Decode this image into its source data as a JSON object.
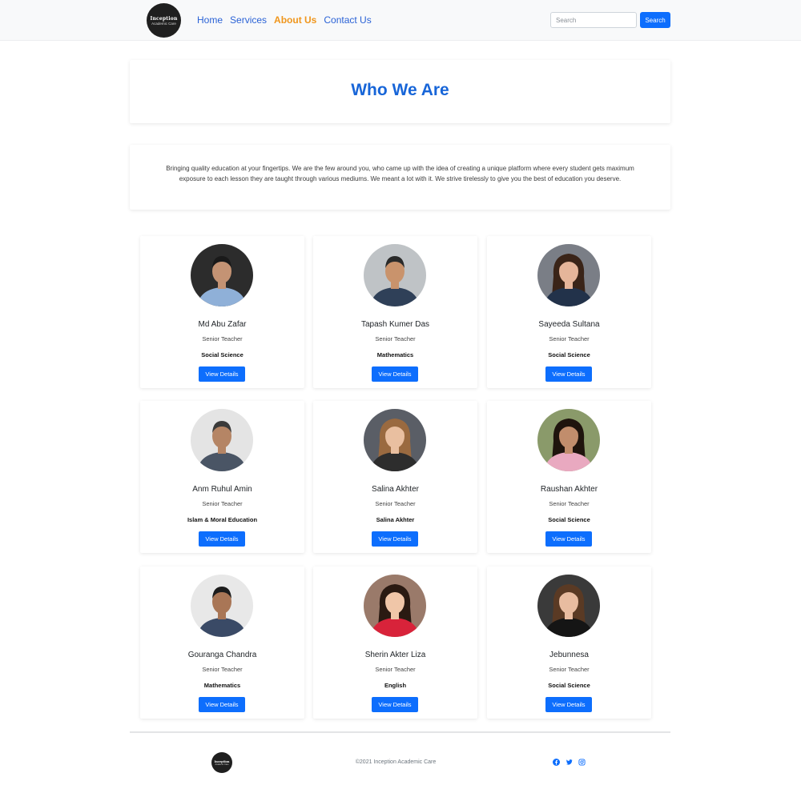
{
  "navbar": {
    "logo_line1": "Inception",
    "logo_line2": "Academic Care",
    "links": [
      "Home",
      "Services",
      "About Us",
      "Contact Us"
    ],
    "search_placeholder": "Search",
    "search_button": "Search"
  },
  "hero": {
    "title": "Who We Are"
  },
  "intro": {
    "text": "Bringing quality education at your fingertips. We are the few around you, who came up with the idea of creating a unique platform where every student gets maximum exposure to each lesson they are taught through various mediums. We meant a lot with it. We strive tirelessly to give you the best of education you deserve."
  },
  "teachers": [
    {
      "name": "Md Abu Zafar",
      "role": "Senior Teacher",
      "subject": "Social Science",
      "button": "View Details"
    },
    {
      "name": "Tapash Kumer Das",
      "role": "Senior Teacher",
      "subject": "Mathematics",
      "button": "View Details"
    },
    {
      "name": "Sayeeda Sultana",
      "role": "Senior Teacher",
      "subject": "Social Science",
      "button": "View Details"
    },
    {
      "name": "Anm Ruhul Amin",
      "role": "Senior Teacher",
      "subject": "Islam & Moral Education",
      "button": "View Details"
    },
    {
      "name": "Salina Akhter",
      "role": "Senior Teacher",
      "subject": "Salina Akhter",
      "button": "View Details"
    },
    {
      "name": "Raushan Akhter",
      "role": "Senior Teacher",
      "subject": "Social Science",
      "button": "View Details"
    },
    {
      "name": "Gouranga Chandra",
      "role": "Senior Teacher",
      "subject": "Mathematics",
      "button": "View Details"
    },
    {
      "name": "Sherin Akter Liza",
      "role": "Senior Teacher",
      "subject": "English",
      "button": "View Details"
    },
    {
      "name": "Jebunnesa",
      "role": "Senior Teacher",
      "subject": "Social Science",
      "button": "View Details"
    }
  ],
  "footer": {
    "logo_line1": "Inception",
    "logo_line2": "Academic Care",
    "copyright": "©2021 Inception Academic Care",
    "social_icons": [
      "facebook-icon",
      "twitter-icon",
      "instagram-icon"
    ]
  },
  "colors": {
    "primary": "#0d6efd",
    "heading": "#1765d8",
    "active_nav": "#f0961c"
  }
}
